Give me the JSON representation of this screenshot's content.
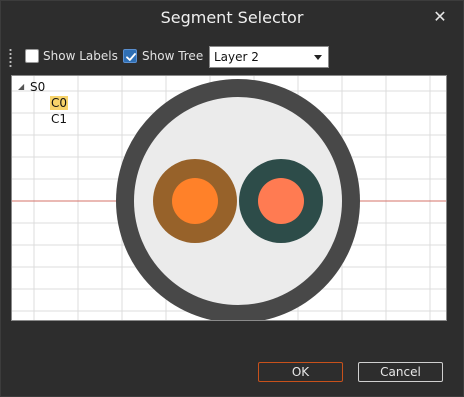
{
  "window": {
    "title": "Segment Selector",
    "close_glyph": "✕"
  },
  "toolbar": {
    "show_labels": {
      "label": "Show Labels",
      "checked": false
    },
    "show_tree": {
      "label": "Show Tree",
      "checked": true
    },
    "layer_select": {
      "value": "Layer 2"
    }
  },
  "tree": {
    "root": {
      "label": "S0",
      "expander": "◢"
    },
    "children": [
      {
        "label": "C0",
        "selected": true
      },
      {
        "label": "C1",
        "selected": false
      }
    ]
  },
  "colors": {
    "outer_ring": "#484848",
    "inner_fill": "#ebebeb",
    "segment_left_outer": "#97622a",
    "segment_left_inner": "#ff8129",
    "segment_right_outer": "#2d4c49",
    "segment_right_inner": "#ff7b52",
    "axis_line": "#d4736a",
    "grid": "#dcdcdc",
    "selection_highlight": "#f7d36a",
    "ok_border": "#c8511b"
  },
  "buttons": {
    "ok": "OK",
    "cancel": "Cancel"
  }
}
